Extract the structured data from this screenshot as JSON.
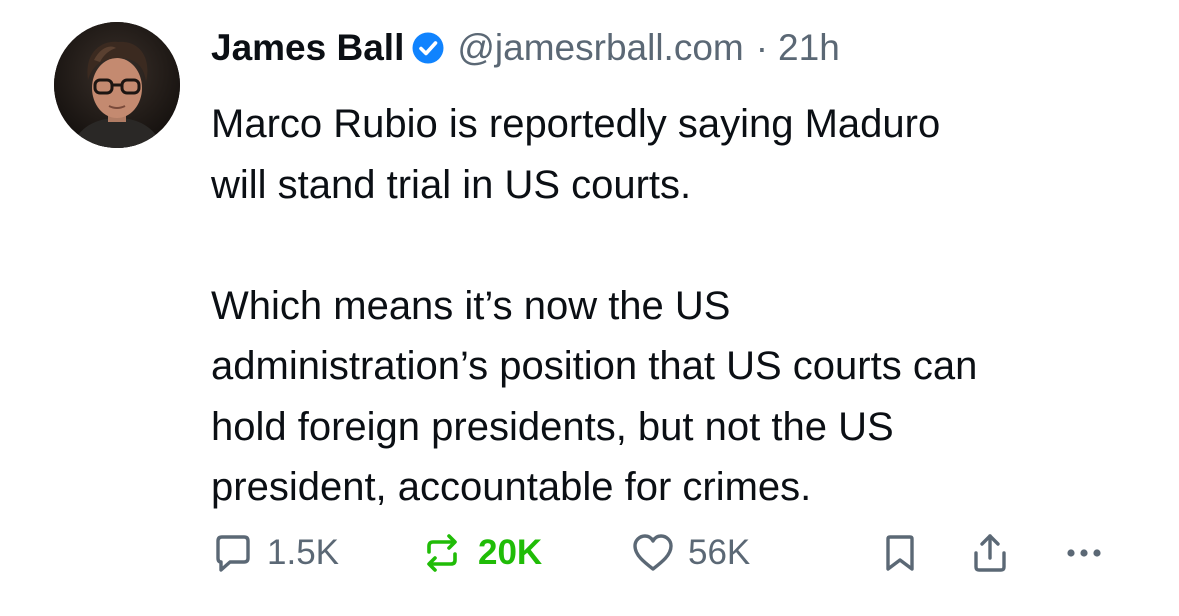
{
  "post": {
    "author": {
      "name": "James Ball",
      "verified": true,
      "handle": "@jamesrball.com",
      "separator": "·",
      "time": "21h"
    },
    "paragraphs": [
      [
        "Marco Rubio is reportedly saying Maduro",
        "will stand trial in US courts."
      ],
      [
        "Which means it’s now the US",
        "administration’s position that US courts can",
        "hold foreign presidents, but not the US",
        "president, accountable for crimes."
      ]
    ],
    "actions": {
      "replies": "1.5K",
      "reposts": "20K",
      "likes": "56K"
    },
    "icons": {
      "reply": "speech-bubble-icon",
      "repost": "repost-arrows-icon",
      "like": "heart-icon",
      "bookmark": "bookmark-icon",
      "share": "share-icon",
      "more": "more-dots-icon",
      "verified": "verified-check-icon"
    },
    "colors": {
      "text": "#0b0f14",
      "muted": "#5b6875",
      "verified": "#1083fe",
      "repost_active": "#20bc07"
    }
  }
}
